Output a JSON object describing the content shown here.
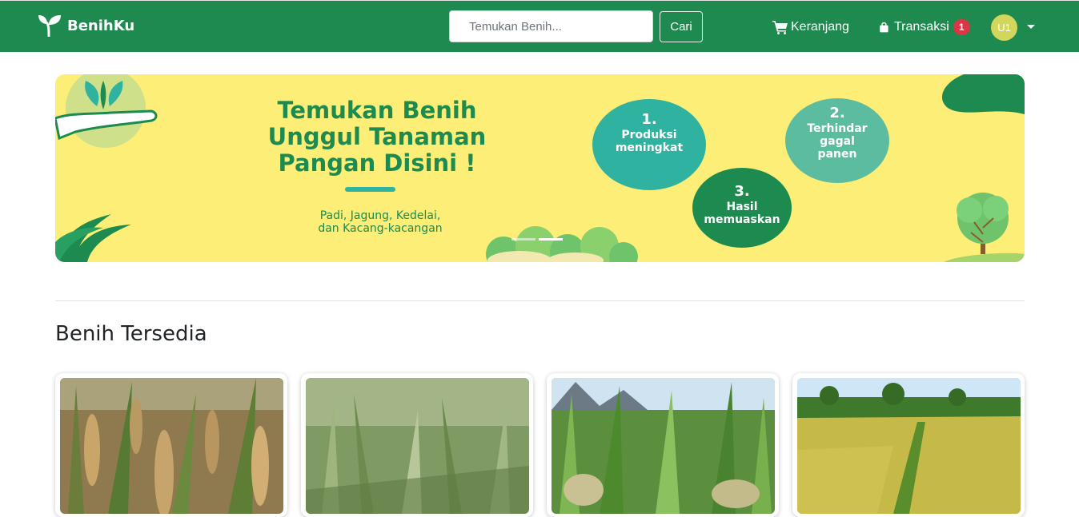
{
  "navbar": {
    "brand": "BenihKu",
    "search_placeholder": "Temukan Benih...",
    "search_button": "Cari",
    "cart_label": "Keranjang",
    "transactions_label": "Transaksi",
    "transactions_badge": "1",
    "avatar_initials": "U1",
    "colors": {
      "background": "#1e8a4f",
      "badge": "#dc3545",
      "avatar": "#d2d75c"
    }
  },
  "banner": {
    "title_line1": "Temukan Benih",
    "title_line2": "Unggul Tanaman",
    "title_line3": "Pangan Disini !",
    "subtitle_line1": "Padi, Jagung, Kedelai,",
    "subtitle_line2": "dan Kacang-kacangan",
    "steps": [
      {
        "number": "1.",
        "label_line1": "Produksi",
        "label_line2": "meningkat"
      },
      {
        "number": "2.",
        "label_line1": "Terhindar",
        "label_line2": "gagal",
        "label_line3": "panen"
      },
      {
        "number": "3.",
        "label_line1": "Hasil",
        "label_line2": "memuaskan"
      }
    ],
    "colors": {
      "background": "#fcee76",
      "primary_green": "#1d8a4f",
      "teal": "#2fb3a0"
    }
  },
  "main": {
    "section_title": "Benih Tersedia",
    "products": [
      {
        "image": "rice-plants-ripe-photo"
      },
      {
        "image": "rice-seedlings-photo"
      },
      {
        "image": "rice-stalks-mountain-photo"
      },
      {
        "image": "rice-field-landscape-photo"
      }
    ]
  }
}
